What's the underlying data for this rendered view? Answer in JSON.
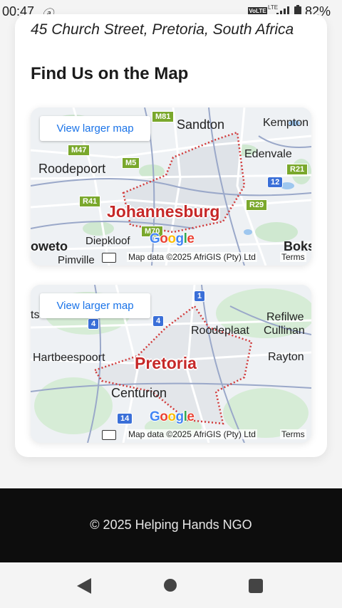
{
  "status_bar": {
    "time": "00:47",
    "notification_icon": "app-notification",
    "volte": "VoLTE",
    "lte": "LTE",
    "battery_percent": "82%"
  },
  "contact": {
    "address": "45 Church Street, Pretoria, South Africa",
    "map_heading": "Find Us on the Map"
  },
  "maps": [
    {
      "view_larger_label": "View larger map",
      "city": "Johannesburg",
      "labels": {
        "sandton": "Sandton",
        "kempton": "Kempton",
        "edenvale": "Edenvale",
        "roodepoort": "Roodepoort",
        "soweto": "oweto",
        "diepkloof": "Diepkloof",
        "pimville": "Pimville",
        "boks": "Boks"
      },
      "shields": {
        "m81": "M81",
        "m47": "M47",
        "m5": "M5",
        "r41": "R41",
        "r29": "R29",
        "m70": "M70",
        "r21": "R21",
        "n12": "12"
      },
      "attribution": "Map data ©2025 AfriGIS (Pty) Ltd",
      "terms": "Terms"
    },
    {
      "view_larger_label": "View larger map",
      "city": "Pretoria",
      "labels": {
        "refilwe": "Refilwe",
        "roodeplaat": "Roodeplaat",
        "cullinan": "Cullinan",
        "hartbeespoort": "Hartbeespoort",
        "rayton": "Rayton",
        "centurion": "Centurion",
        "ts": "ts"
      },
      "shields": {
        "n1": "1",
        "n4a": "4",
        "n4b": "4",
        "n14": "14"
      },
      "attribution": "Map data ©2025 AfriGIS (Pty) Ltd",
      "terms": "Terms"
    }
  ],
  "google_logo": "Google",
  "footer": {
    "copyright": "© 2025 Helping Hands NGO"
  },
  "colors": {
    "city_label": "#c62828",
    "link": "#1a73e8",
    "footer_bg": "#0d0d0d"
  }
}
